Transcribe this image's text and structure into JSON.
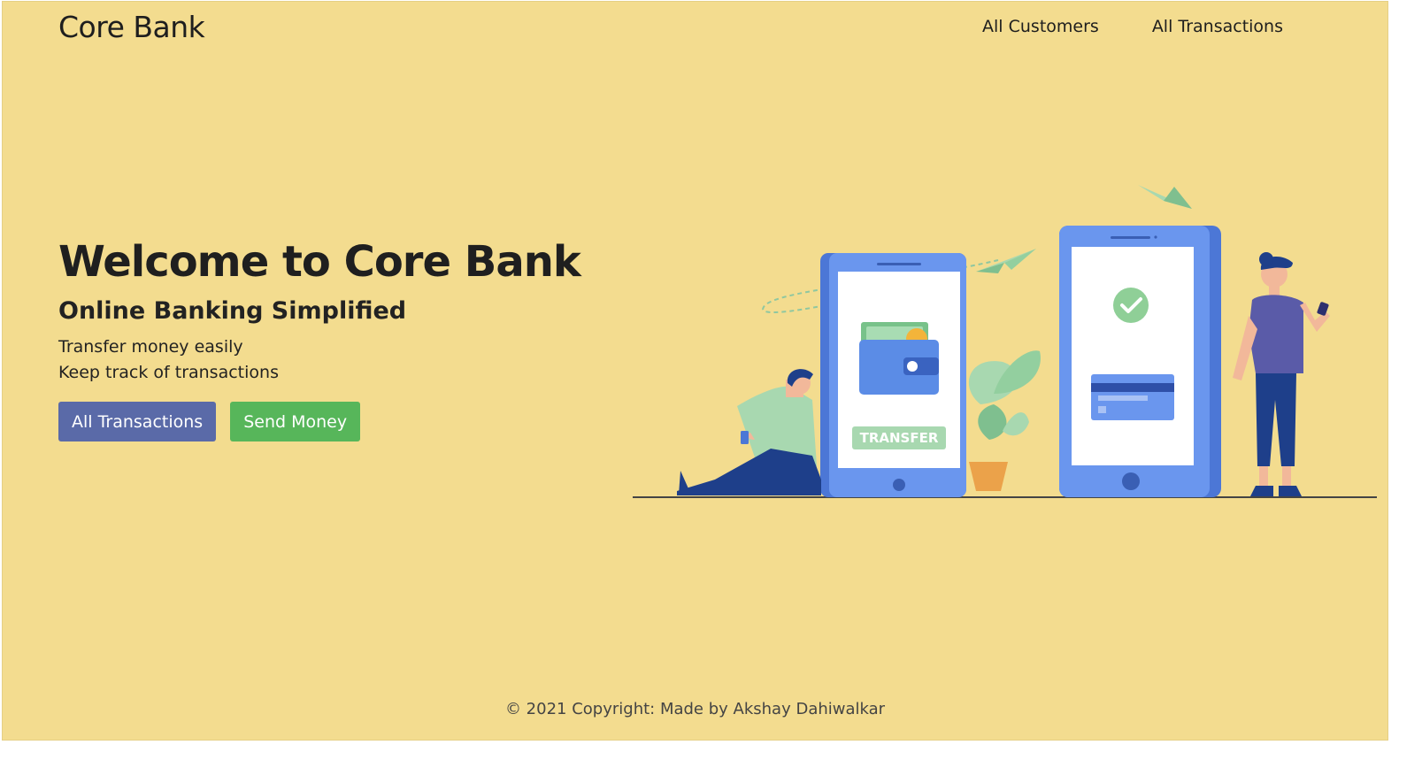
{
  "navbar": {
    "brand": "Core Bank",
    "links": [
      "All Customers",
      "All Transactions"
    ]
  },
  "hero": {
    "title": "Welcome to Core Bank",
    "subtitle": "Online Banking Simplified",
    "lines": [
      "Transfer money easily",
      "Keep track of transactions"
    ],
    "buttons": {
      "primary_label": "All Transactions",
      "success_label": "Send Money"
    }
  },
  "illustration": {
    "transfer_label": "TRANSFER"
  },
  "footer": {
    "copyright": "© 2021 Copyright: Made by Akshay Dahiwalkar"
  },
  "colors": {
    "background": "#f3dc8f",
    "primary_button": "#5a6aa8",
    "success_button": "#57b65a",
    "phone_blue": "#6a96ee",
    "phone_blue_dark": "#4c77d6"
  }
}
